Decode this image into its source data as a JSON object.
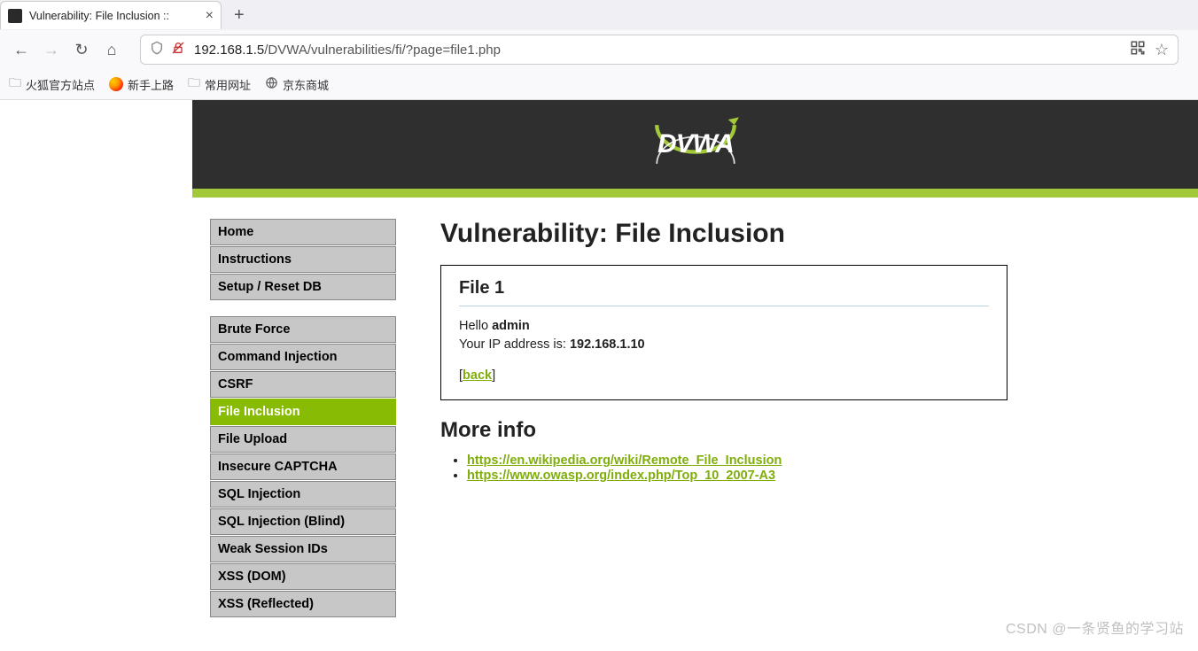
{
  "browser": {
    "tab_title": "Vulnerability: File Inclusion ::",
    "url": "192.168.1.5/DVWA/vulnerabilities/fi/?page=file1.php",
    "url_host": "192.168.1.5",
    "url_path": "/DVWA/vulnerabilities/fi/?page=file1.php",
    "bookmarks": [
      {
        "label": "火狐官方站点",
        "icon": "folder"
      },
      {
        "label": "新手上路",
        "icon": "firefox"
      },
      {
        "label": "常用网址",
        "icon": "folder"
      },
      {
        "label": "京东商城",
        "icon": "globe"
      }
    ]
  },
  "logo": {
    "text": "DVWA"
  },
  "sidebar": {
    "group1": [
      {
        "label": "Home"
      },
      {
        "label": "Instructions"
      },
      {
        "label": "Setup / Reset DB"
      }
    ],
    "group2": [
      {
        "label": "Brute Force"
      },
      {
        "label": "Command Injection"
      },
      {
        "label": "CSRF"
      },
      {
        "label": "File Inclusion",
        "active": true
      },
      {
        "label": "File Upload"
      },
      {
        "label": "Insecure CAPTCHA"
      },
      {
        "label": "SQL Injection"
      },
      {
        "label": "SQL Injection (Blind)"
      },
      {
        "label": "Weak Session IDs"
      },
      {
        "label": "XSS (DOM)"
      },
      {
        "label": "XSS (Reflected)"
      }
    ]
  },
  "content": {
    "title": "Vulnerability: File Inclusion",
    "box_heading": "File 1",
    "hello_prefix": "Hello ",
    "username": "admin",
    "ip_prefix": "Your IP address is: ",
    "ip": "192.168.1.10",
    "back_label": "back",
    "more_info_heading": "More info",
    "links": [
      "https://en.wikipedia.org/wiki/Remote_File_Inclusion",
      "https://www.owasp.org/index.php/Top_10_2007-A3"
    ]
  },
  "watermark": "CSDN @一条贤鱼的学习站"
}
